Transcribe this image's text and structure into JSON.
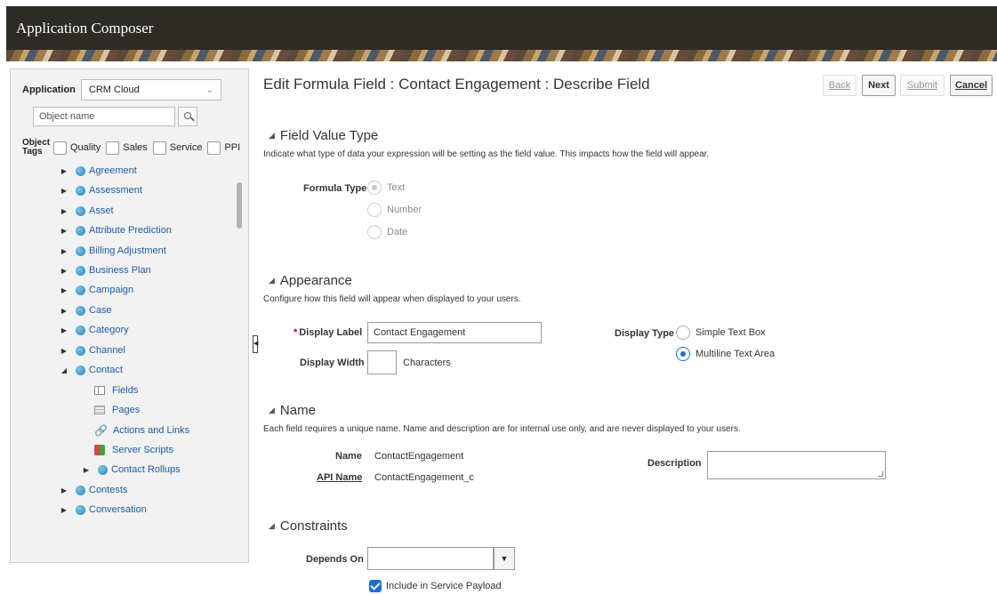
{
  "header": {
    "title": "Application Composer"
  },
  "sidebar": {
    "application_label": "Application",
    "application_value": "CRM Cloud",
    "search_placeholder": "Object name",
    "object_tags_label": "Object Tags",
    "tags": [
      "Quality",
      "Sales",
      "Service",
      "PPI"
    ],
    "tree": [
      {
        "label": "Agreement",
        "state": "collapsed"
      },
      {
        "label": "Assessment",
        "state": "collapsed"
      },
      {
        "label": "Asset",
        "state": "collapsed"
      },
      {
        "label": "Attribute Prediction",
        "state": "collapsed"
      },
      {
        "label": "Billing Adjustment",
        "state": "collapsed"
      },
      {
        "label": "Business Plan",
        "state": "collapsed"
      },
      {
        "label": "Campaign",
        "state": "collapsed"
      },
      {
        "label": "Case",
        "state": "collapsed"
      },
      {
        "label": "Category",
        "state": "collapsed"
      },
      {
        "label": "Channel",
        "state": "collapsed"
      },
      {
        "label": "Contact",
        "state": "expanded"
      },
      {
        "label": "Fields",
        "state": "child",
        "icon": "fields-icon"
      },
      {
        "label": "Pages",
        "state": "child",
        "icon": "pages-icon"
      },
      {
        "label": "Actions and Links",
        "state": "child",
        "icon": "links-icon"
      },
      {
        "label": "Server Scripts",
        "state": "child",
        "icon": "scripts-icon"
      },
      {
        "label": "Contact Rollups",
        "state": "child-collapsed"
      },
      {
        "label": "Contests",
        "state": "collapsed"
      },
      {
        "label": "Conversation",
        "state": "collapsed"
      }
    ]
  },
  "main": {
    "title": "Edit Formula Field : Contact Engagement : Describe Field",
    "buttons": {
      "back": "Back",
      "next": "Next",
      "submit": "Submit",
      "cancel": "Cancel"
    },
    "field_value_type": {
      "heading": "Field Value Type",
      "description": "Indicate what type of data your expression will be setting as the field value. This impacts how the field will appear.",
      "formula_type_label": "Formula Type",
      "options": [
        "Text",
        "Number",
        "Date"
      ],
      "selected": "Text"
    },
    "appearance": {
      "heading": "Appearance",
      "description": "Configure how this field will appear when displayed to your users.",
      "display_label_label": "Display Label",
      "display_label_value": "Contact Engagement",
      "display_width_label": "Display Width",
      "display_width_value": "",
      "characters_label": "Characters",
      "display_type_label": "Display Type",
      "display_type_options": [
        "Simple Text Box",
        "Multiline Text Area"
      ],
      "display_type_selected": "Multiline Text Area"
    },
    "name": {
      "heading": "Name",
      "description": "Each field requires a unique name. Name and description are for internal use only, and are never displayed to your users.",
      "name_label": "Name",
      "name_value": "ContactEngagement",
      "api_name_label": "API Name",
      "api_name_value": "ContactEngagement_c",
      "description_label": "Description",
      "description_value": ""
    },
    "constraints": {
      "heading": "Constraints",
      "depends_on_label": "Depends On",
      "depends_on_value": "",
      "include_payload_label": "Include in Service Payload",
      "include_payload_checked": true
    }
  },
  "colors": {
    "header_bg": "#2d2b26",
    "link": "#1f5aa6",
    "accent": "#1a6fd6"
  }
}
